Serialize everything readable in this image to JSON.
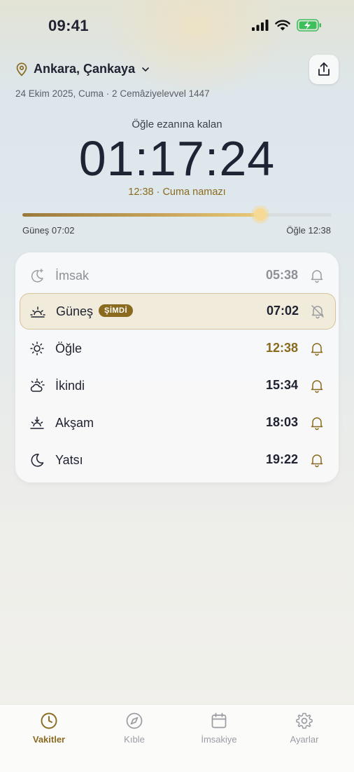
{
  "status_bar": {
    "time": "09:41"
  },
  "header": {
    "location": "Ankara, Çankaya",
    "date_line": "24 Ekim 2025, Cuma · 2 Cemâziyelevvel 1447"
  },
  "countdown": {
    "label": "Öğle ezanına kalan",
    "value": "01:17:24",
    "subtitle": "12:38 · Cuma namazı"
  },
  "progress": {
    "fraction": 0.77,
    "start_label": "Güneş 07:02",
    "end_label": "Öğle 12:38"
  },
  "prayers": [
    {
      "name": "İmsak",
      "time": "05:38",
      "icon": "crescent-star-icon",
      "state": "past",
      "bell": "bell-icon"
    },
    {
      "name": "Güneş",
      "time": "07:02",
      "icon": "sunrise-icon",
      "state": "active",
      "bell": "bell-off-icon",
      "badge": "ŞİMDİ"
    },
    {
      "name": "Öğle",
      "time": "12:38",
      "icon": "sun-icon",
      "state": "next",
      "bell": "bell-icon"
    },
    {
      "name": "İkindi",
      "time": "15:34",
      "icon": "sun-cloud-icon",
      "state": "upcoming",
      "bell": "bell-icon"
    },
    {
      "name": "Akşam",
      "time": "18:03",
      "icon": "sunset-icon",
      "state": "upcoming",
      "bell": "bell-icon"
    },
    {
      "name": "Yatsı",
      "time": "19:22",
      "icon": "moon-icon",
      "state": "upcoming",
      "bell": "bell-icon"
    }
  ],
  "tabs": [
    {
      "label": "Vakitler",
      "icon": "clock-icon",
      "active": true
    },
    {
      "label": "Kıble",
      "icon": "compass-icon",
      "active": false
    },
    {
      "label": "İmsakiye",
      "icon": "calendar-icon",
      "active": false
    },
    {
      "label": "Ayarlar",
      "icon": "gear-icon",
      "active": false
    }
  ],
  "colors": {
    "accent": "#8a6a1e",
    "text": "#1f2230",
    "muted": "#8d9096",
    "active_row_bg": "#f1ebdc"
  }
}
